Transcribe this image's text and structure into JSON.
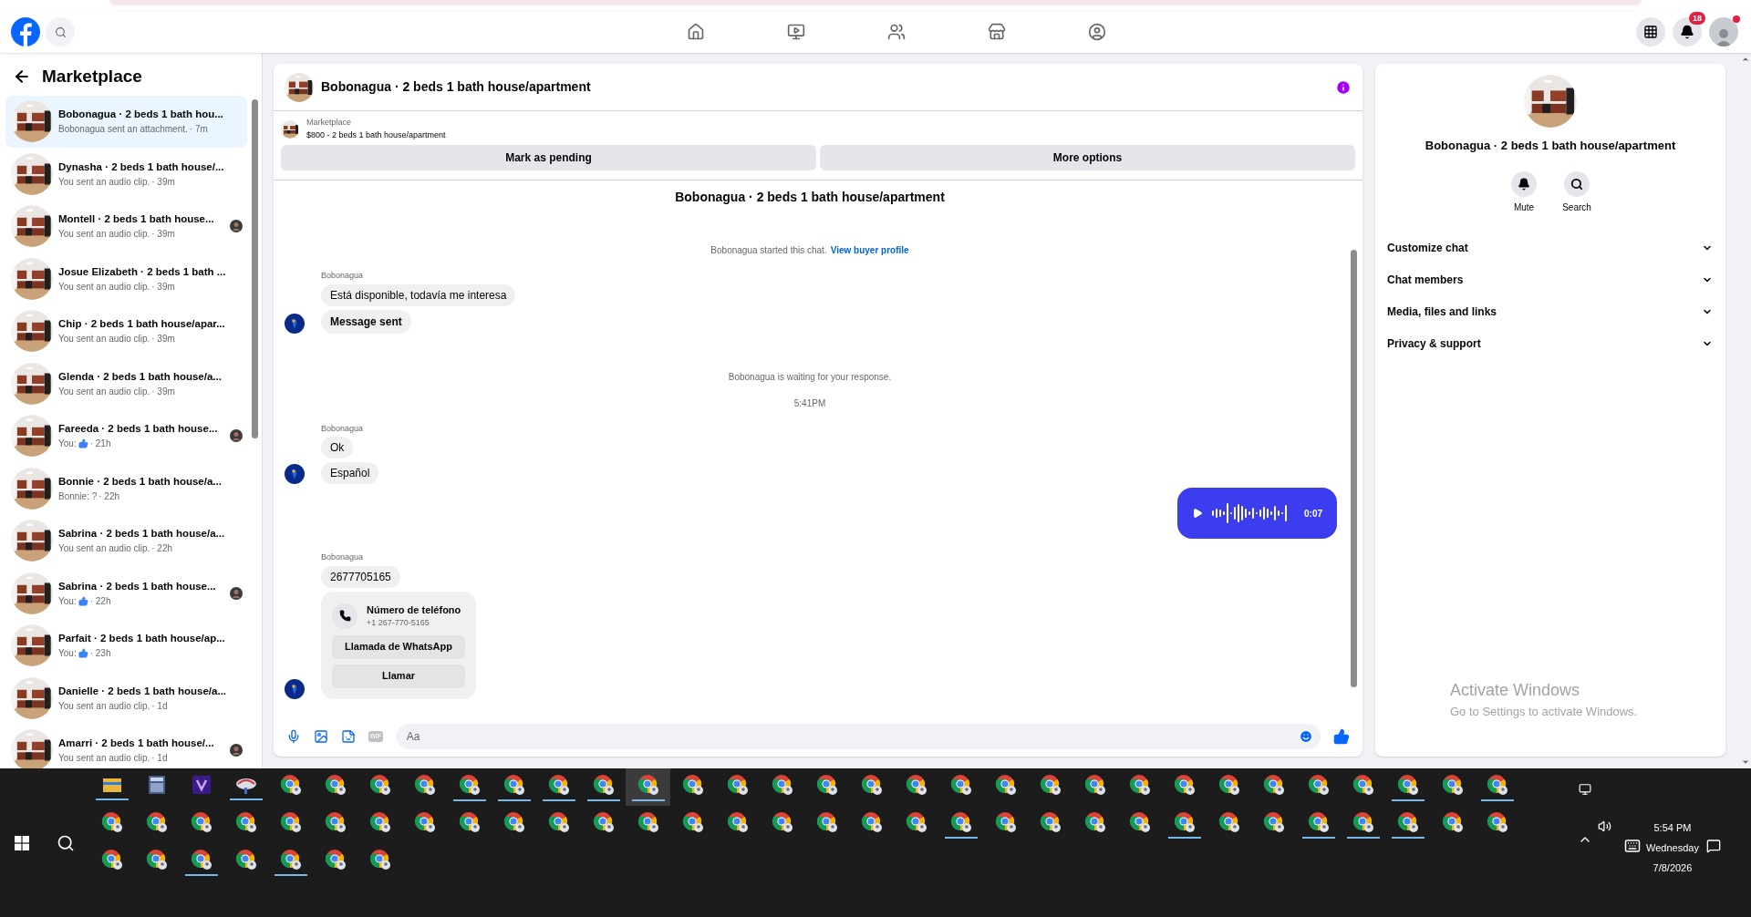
{
  "topbar": {
    "notifications": "18"
  },
  "sidebar": {
    "title": "Marketplace",
    "conversations": [
      {
        "name": "Bobonagua · 2 beds 1 bath hou...",
        "preview": "Bobonagua sent an attachment.",
        "like": false,
        "time": "· 7m",
        "seen": false,
        "selected": true
      },
      {
        "name": "Dynasha · 2 beds 1 bath house/...",
        "preview": "You sent an audio clip.",
        "like": false,
        "time": "· 39m",
        "seen": false,
        "selected": false
      },
      {
        "name": "Montell · 2 beds 1 bath house...",
        "preview": "You sent an audio clip.",
        "like": false,
        "time": "· 39m",
        "seen": true,
        "selected": false
      },
      {
        "name": "Josue Elizabeth · 2 beds 1 bath ...",
        "preview": "You sent an audio clip.",
        "like": false,
        "time": "· 39m",
        "seen": false,
        "selected": false
      },
      {
        "name": "Chip · 2 beds 1 bath house/apar...",
        "preview": "You sent an audio clip.",
        "like": false,
        "time": "· 39m",
        "seen": false,
        "selected": false
      },
      {
        "name": "Glenda · 2 beds 1 bath house/a...",
        "preview": "You sent an audio clip.",
        "like": false,
        "time": "· 39m",
        "seen": false,
        "selected": false
      },
      {
        "name": "Fareeda · 2 beds 1 bath house...",
        "preview": "You:",
        "like": true,
        "time": "· 21h",
        "seen": true,
        "selected": false
      },
      {
        "name": "Bonnie · 2 beds 1 bath house/a...",
        "preview": "Bonnie: ?",
        "like": false,
        "time": "· 22h",
        "seen": false,
        "selected": false
      },
      {
        "name": "Sabrina · 2 beds 1 bath house/a...",
        "preview": "You sent an audio clip.",
        "like": false,
        "time": "· 22h",
        "seen": false,
        "selected": false
      },
      {
        "name": "Sabrina · 2 beds 1 bath house...",
        "preview": "You:",
        "like": true,
        "time": "· 22h",
        "seen": true,
        "selected": false
      },
      {
        "name": "Parfait · 2 beds 1 bath house/ap...",
        "preview": "You:",
        "like": true,
        "time": "· 23h",
        "seen": false,
        "selected": false
      },
      {
        "name": "Danielle · 2 beds 1 bath house/a...",
        "preview": "You sent an audio clip.",
        "like": false,
        "time": "· 1d",
        "seen": false,
        "selected": false
      },
      {
        "name": "Amarri · 2 beds 1 bath house/...",
        "preview": "You sent an audio clip.",
        "like": false,
        "time": "· 1d",
        "seen": true,
        "selected": false
      }
    ]
  },
  "chat": {
    "title": "Bobonagua · 2 beds 1 bath house/apartment",
    "listing": {
      "source": "Marketplace",
      "summary": "$800 - 2 beds 1 bath house/apartment",
      "actions": [
        "Mark as pending",
        "More options"
      ]
    },
    "messages": [
      {
        "kind": "title",
        "text": "Bobonagua · 2 beds 1 bath house/apartment"
      },
      {
        "kind": "system",
        "text": "Bobonagua started this chat.",
        "link": "View buyer profile"
      },
      {
        "kind": "incoming",
        "sender": "Bobonagua",
        "bubbles": [
          {
            "kind": "text",
            "text": "Está disponible, todavía me interesa"
          },
          {
            "kind": "notice",
            "text": "Message sent"
          }
        ]
      },
      {
        "kind": "system",
        "text": "Bobonagua is waiting for your response."
      },
      {
        "kind": "time",
        "text": "5:41PM"
      },
      {
        "kind": "incoming",
        "sender": "Bobonagua",
        "bubbles": [
          {
            "kind": "text",
            "text": "Ok"
          },
          {
            "kind": "text",
            "text": "Español"
          }
        ]
      },
      {
        "kind": "audio",
        "duration": "0:07"
      },
      {
        "kind": "incoming",
        "sender": "Bobonagua",
        "bubbles": [
          {
            "kind": "text",
            "text": "2677705165"
          },
          {
            "kind": "phone",
            "title": "Número de teléfono",
            "number": "+1 267-770-5165",
            "actions": [
              "Llamada de WhatsApp",
              "Llamar"
            ]
          }
        ]
      }
    ],
    "composer": {
      "gif": "GIF",
      "placeholder": "Aa"
    }
  },
  "details": {
    "title": "Bobonagua · 2 beds 1 bath house/apartment",
    "actions": [
      "Mute",
      "Search"
    ],
    "sections": [
      {
        "label": "Customize chat",
        "expanded": false
      },
      {
        "label": "Chat members",
        "expanded": false
      },
      {
        "label": "Media, files and links",
        "expanded": false
      },
      {
        "label": "Privacy & support",
        "expanded": false
      }
    ]
  },
  "activation": {
    "title": "Activate Windows",
    "text": "Go to Settings to activate Windows."
  },
  "taskbar": {
    "apps": [
      {
        "kind": "folder",
        "open": true,
        "active": false
      },
      {
        "kind": "calculator",
        "open": false,
        "active": false
      },
      {
        "kind": "purple-app",
        "open": false,
        "active": false
      },
      {
        "kind": "disc-app",
        "open": true,
        "active": false
      },
      {
        "kind": "chrome",
        "open": false,
        "active": false
      },
      {
        "kind": "chrome",
        "open": false,
        "active": false
      },
      {
        "kind": "chrome",
        "open": false,
        "active": false
      },
      {
        "kind": "chrome",
        "open": false,
        "active": false
      },
      {
        "kind": "chrome",
        "open": true,
        "active": false
      },
      {
        "kind": "chrome",
        "open": true,
        "active": false
      },
      {
        "kind": "chrome",
        "open": true,
        "active": false
      },
      {
        "kind": "chrome",
        "open": true,
        "active": false
      },
      {
        "kind": "chrome",
        "open": true,
        "active": true
      },
      {
        "kind": "chrome",
        "open": false,
        "active": false
      },
      {
        "kind": "chrome",
        "open": false,
        "active": false
      },
      {
        "kind": "chrome",
        "open": false,
        "active": false
      },
      {
        "kind": "chrome",
        "open": false,
        "active": false
      },
      {
        "kind": "chrome",
        "open": false,
        "active": false
      },
      {
        "kind": "chrome",
        "open": false,
        "active": false
      },
      {
        "kind": "chrome",
        "open": false,
        "active": false
      },
      {
        "kind": "chrome",
        "open": false,
        "active": false
      },
      {
        "kind": "chrome",
        "open": false,
        "active": false
      },
      {
        "kind": "chrome",
        "open": false,
        "active": false
      },
      {
        "kind": "chrome",
        "open": false,
        "active": false
      },
      {
        "kind": "chrome",
        "open": false,
        "active": false
      },
      {
        "kind": "chrome",
        "open": false,
        "active": false
      },
      {
        "kind": "chrome",
        "open": false,
        "active": false
      },
      {
        "kind": "chrome",
        "open": false,
        "active": false
      },
      {
        "kind": "chrome",
        "open": false,
        "active": false
      },
      {
        "kind": "chrome",
        "open": true,
        "active": false
      },
      {
        "kind": "chrome",
        "open": false,
        "active": false
      },
      {
        "kind": "chrome",
        "open": true,
        "active": false
      },
      {
        "kind": "chrome",
        "open": false,
        "active": false
      },
      {
        "kind": "chrome",
        "open": false,
        "active": false
      },
      {
        "kind": "chrome",
        "open": false,
        "active": false
      },
      {
        "kind": "chrome",
        "open": false,
        "active": false
      },
      {
        "kind": "chrome",
        "open": false,
        "active": false
      },
      {
        "kind": "chrome",
        "open": false,
        "active": false
      },
      {
        "kind": "chrome",
        "open": false,
        "active": false
      },
      {
        "kind": "chrome",
        "open": false,
        "active": false
      },
      {
        "kind": "chrome",
        "open": false,
        "active": false
      },
      {
        "kind": "chrome",
        "open": false,
        "active": false
      },
      {
        "kind": "chrome",
        "open": false,
        "active": false
      },
      {
        "kind": "chrome",
        "open": false,
        "active": false
      },
      {
        "kind": "chrome",
        "open": false,
        "active": false
      },
      {
        "kind": "chrome",
        "open": false,
        "active": false
      },
      {
        "kind": "chrome",
        "open": false,
        "active": false
      },
      {
        "kind": "chrome",
        "open": false,
        "active": false
      },
      {
        "kind": "chrome",
        "open": false,
        "active": false
      },
      {
        "kind": "chrome",
        "open": false,
        "active": false
      },
      {
        "kind": "chrome",
        "open": false,
        "active": false
      },
      {
        "kind": "chrome",
        "open": true,
        "active": false
      },
      {
        "kind": "chrome",
        "open": false,
        "active": false
      },
      {
        "kind": "chrome",
        "open": false,
        "active": false
      },
      {
        "kind": "chrome",
        "open": false,
        "active": false
      },
      {
        "kind": "chrome",
        "open": false,
        "active": false
      },
      {
        "kind": "chrome",
        "open": true,
        "active": false
      },
      {
        "kind": "chrome",
        "open": false,
        "active": false
      },
      {
        "kind": "chrome",
        "open": false,
        "active": false
      },
      {
        "kind": "chrome",
        "open": true,
        "active": false
      },
      {
        "kind": "chrome",
        "open": true,
        "active": false
      },
      {
        "kind": "chrome",
        "open": true,
        "active": false
      },
      {
        "kind": "chrome",
        "open": false,
        "active": false
      },
      {
        "kind": "chrome",
        "open": false,
        "active": false
      },
      {
        "kind": "chrome",
        "open": false,
        "active": false
      },
      {
        "kind": "chrome",
        "open": false,
        "active": false
      },
      {
        "kind": "chrome",
        "open": true,
        "active": false
      },
      {
        "kind": "chrome",
        "open": false,
        "active": false
      },
      {
        "kind": "chrome",
        "open": true,
        "active": false
      },
      {
        "kind": "chrome",
        "open": false,
        "active": false
      },
      {
        "kind": "chrome",
        "open": false,
        "active": false
      }
    ],
    "time": "5:54 PM",
    "day": "Wednesday",
    "date": "7/8/2026"
  }
}
